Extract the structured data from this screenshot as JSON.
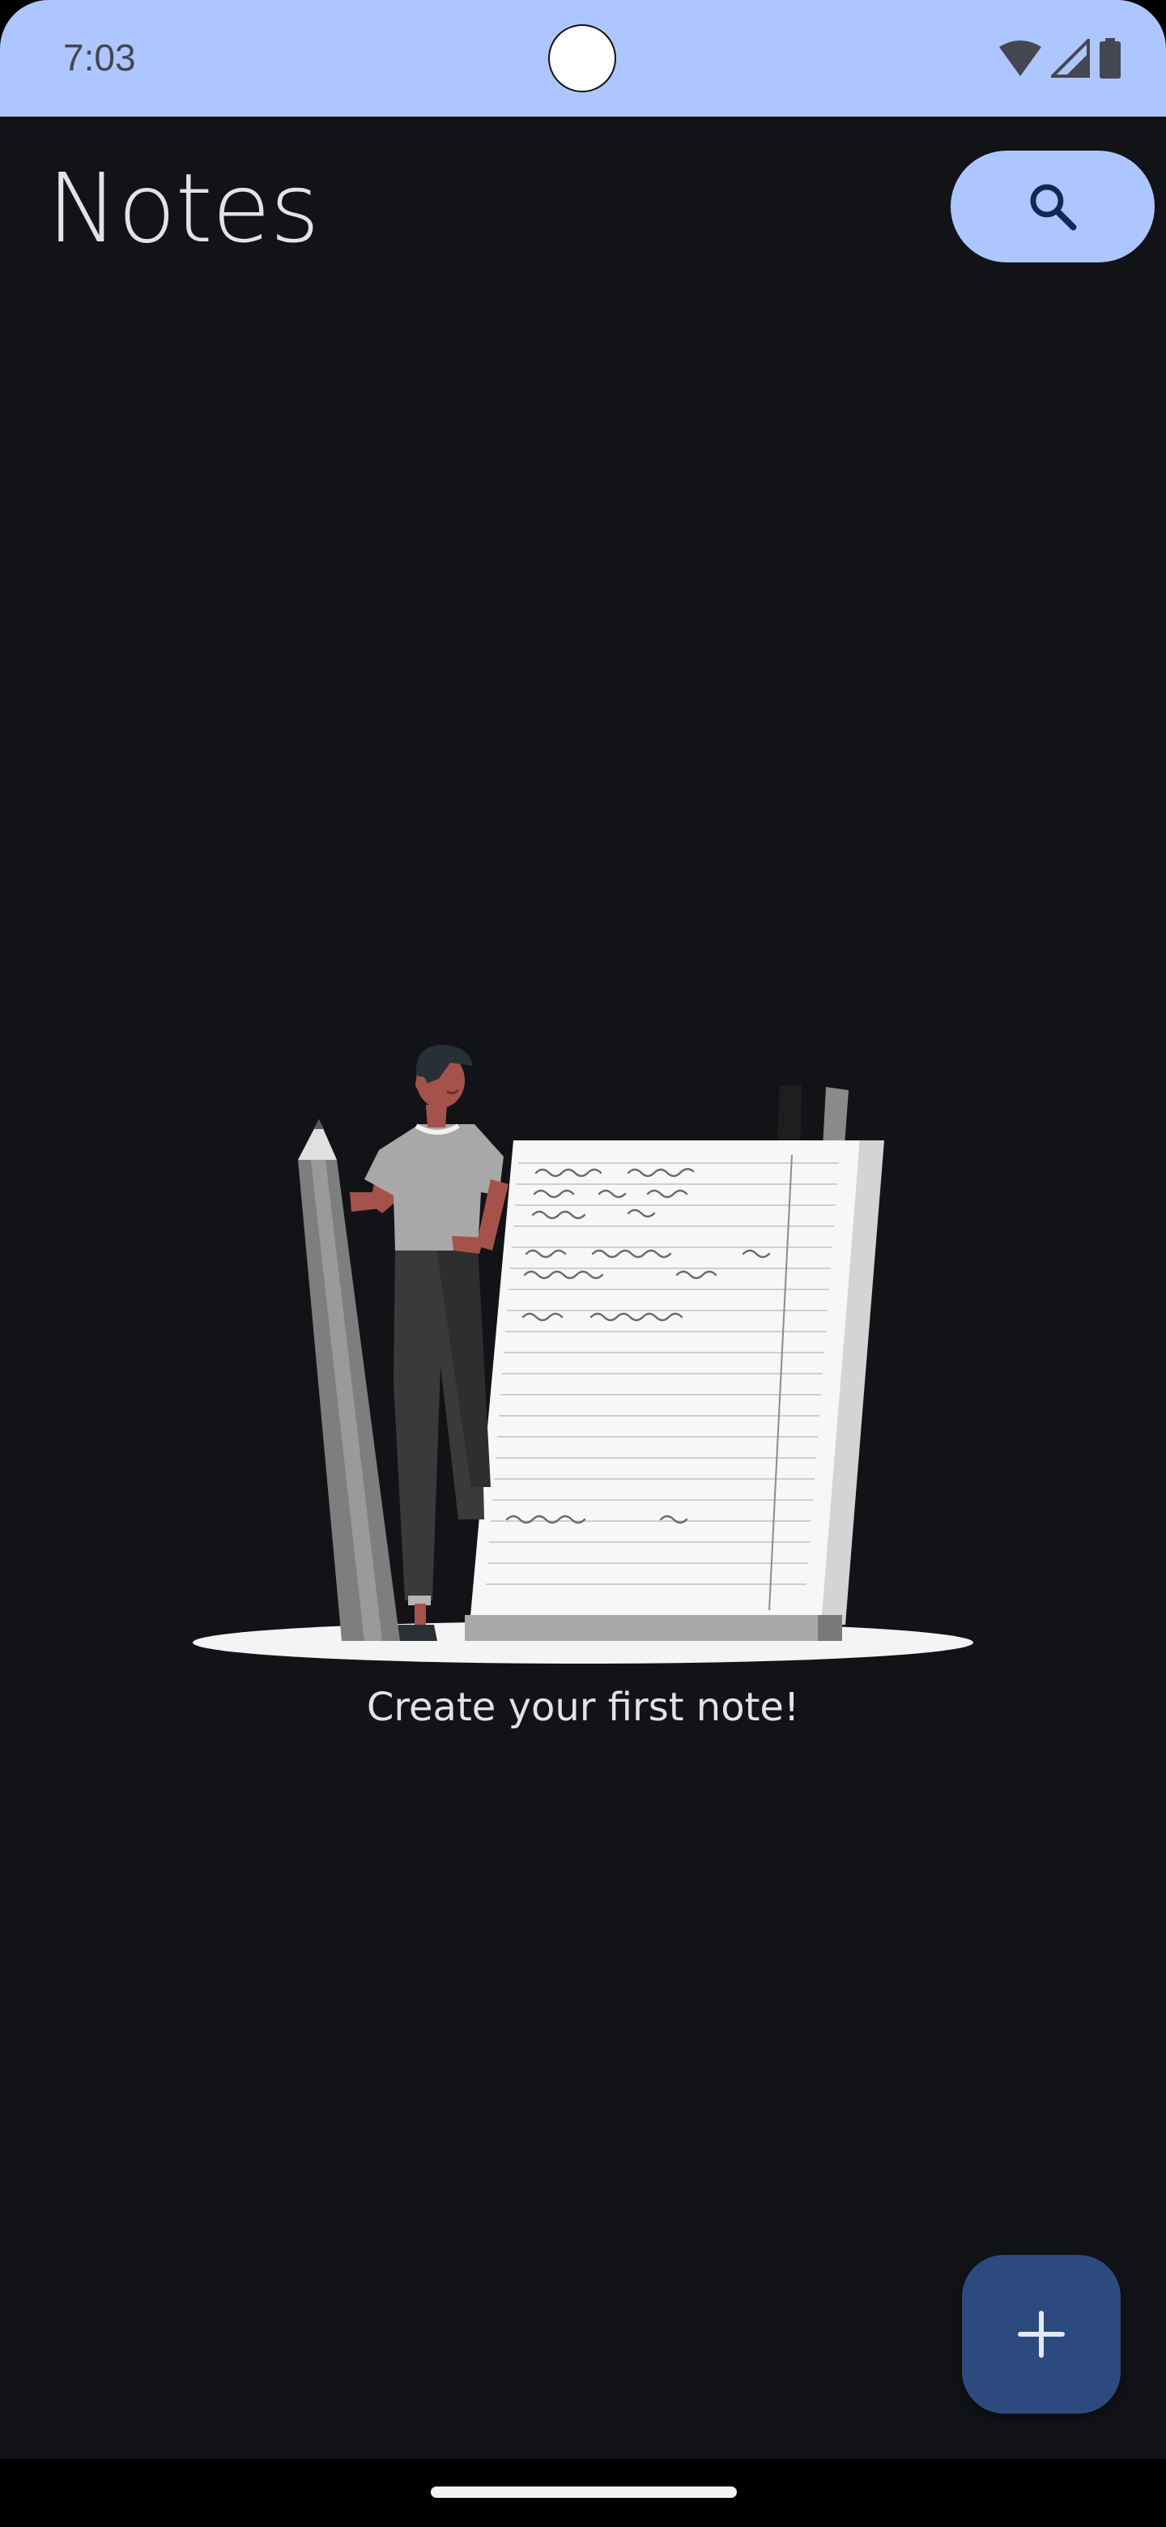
{
  "status_bar": {
    "time": "7:03",
    "icons": [
      "wifi-icon",
      "cellular-signal-icon",
      "battery-icon"
    ]
  },
  "header": {
    "title": "Notes",
    "search_icon": "search-icon"
  },
  "empty_state": {
    "illustration": "person-with-pencil-and-notebook",
    "message": "Create your first note!"
  },
  "fab": {
    "icon": "plus-icon"
  },
  "colors": {
    "background": "#111317",
    "status_bar": "#adc6ff",
    "search_button": "#adc6ff",
    "fab": "#2c4a7e",
    "on_surface": "#e3e2e6"
  }
}
